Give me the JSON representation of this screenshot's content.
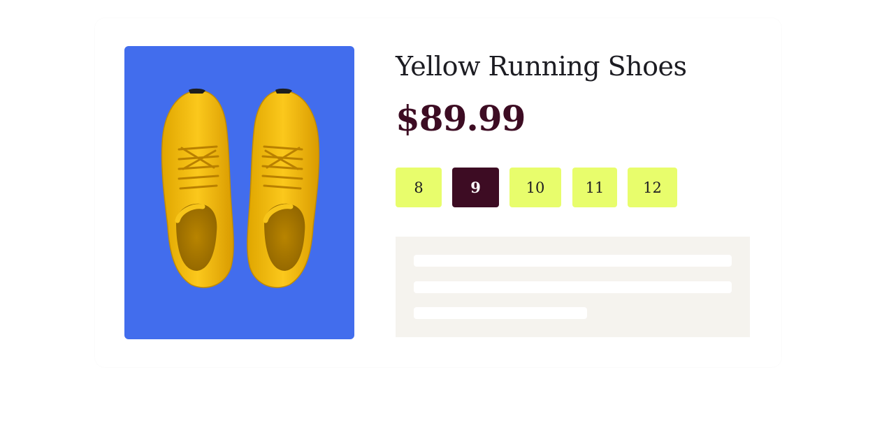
{
  "product": {
    "title": "Yellow Running Shoes",
    "price": "$89.99",
    "image_icon": "yellow-sneakers-image",
    "background_color": "#426ded"
  },
  "sizes": {
    "options": [
      "8",
      "9",
      "10",
      "11",
      "12"
    ],
    "selected": "9"
  },
  "colors": {
    "accent": "#e8fd6c",
    "selected": "#3d0c23",
    "price": "#3d0c23",
    "description_placeholder": "#f5f3ee"
  }
}
